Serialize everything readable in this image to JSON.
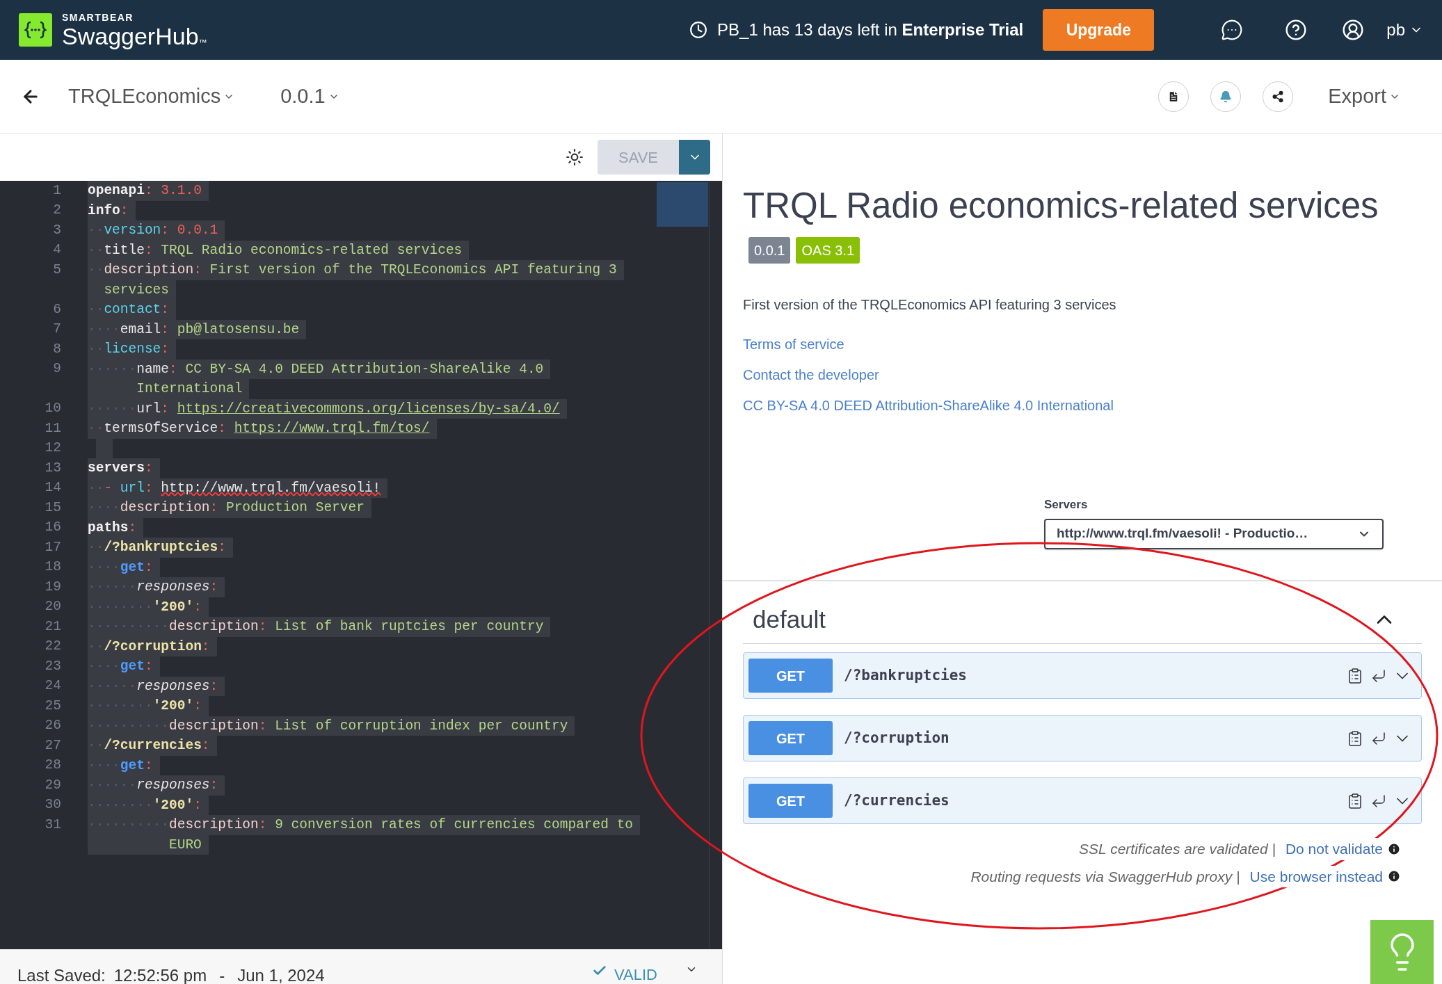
{
  "top_bar": {
    "brand_small": "SMARTBEAR",
    "brand": "SwaggerHub",
    "brand_mark": "™",
    "trial_notice": "PB_1 has 13 days left in **Enterprise Trial**",
    "upgrade_button": "Upgrade",
    "user": "pb"
  },
  "header": {
    "api_name": "TRQLEconomics",
    "version": "0.0.1",
    "export": "Export"
  },
  "editor": {
    "save_button": "SAVE",
    "save_disabled": true,
    "rows": [
      {
        "number": "1",
        "tokens": [
          {
            "kind": "key_bold",
            "text": "openapi"
          },
          {
            "kind": "punct",
            "text": ": "
          },
          {
            "kind": "number",
            "text": "3.1.0"
          }
        ]
      },
      {
        "number": "2",
        "tokens": [
          {
            "kind": "key_bold",
            "text": "info"
          },
          {
            "kind": "punct",
            "text": ":"
          }
        ]
      },
      {
        "number": "3",
        "tokens": [
          {
            "kind": "dots",
            "text": "··"
          },
          {
            "kind": "key_cyan",
            "text": "version"
          },
          {
            "kind": "punct",
            "text": ": "
          },
          {
            "kind": "number",
            "text": "0.0.1"
          }
        ]
      },
      {
        "number": "4",
        "tokens": [
          {
            "kind": "dots",
            "text": "··"
          },
          {
            "kind": "key",
            "text": "title"
          },
          {
            "kind": "punct",
            "text": ": "
          },
          {
            "kind": "string",
            "text": "TRQL Radio economics-related services"
          }
        ]
      },
      {
        "number": "5",
        "tokens": [
          {
            "kind": "dots",
            "text": "··"
          },
          {
            "kind": "key_pink",
            "text": "description"
          },
          {
            "kind": "punct",
            "text": ": "
          },
          {
            "kind": "string",
            "text": "First version of the TRQLEconomics API featuring 3"
          }
        ]
      },
      {
        "tokens": [
          {
            "kind": "string",
            "text": "  services"
          }
        ]
      },
      {
        "number": "6",
        "tokens": [
          {
            "kind": "dots",
            "text": "··"
          },
          {
            "kind": "key_cyan",
            "text": "contact"
          },
          {
            "kind": "punct",
            "text": ":"
          }
        ]
      },
      {
        "number": "7",
        "tokens": [
          {
            "kind": "dots",
            "text": "····"
          },
          {
            "kind": "key",
            "text": "email"
          },
          {
            "kind": "punct",
            "text": ": "
          },
          {
            "kind": "string",
            "text": "pb@latosensu.be"
          }
        ]
      },
      {
        "number": "8",
        "tokens": [
          {
            "kind": "dots",
            "text": "··"
          },
          {
            "kind": "key_cyan",
            "text": "license"
          },
          {
            "kind": "punct",
            "text": ":"
          }
        ]
      },
      {
        "number": "9",
        "tokens": [
          {
            "kind": "dots",
            "text": "······"
          },
          {
            "kind": "key",
            "text": "name"
          },
          {
            "kind": "punct",
            "text": ": "
          },
          {
            "kind": "string",
            "text": "CC BY-SA 4.0 DEED Attribution-ShareAlike 4.0"
          }
        ]
      },
      {
        "tokens": [
          {
            "kind": "string",
            "text": "      International"
          }
        ]
      },
      {
        "number": "10",
        "tokens": [
          {
            "kind": "dots",
            "text": "······"
          },
          {
            "kind": "key",
            "text": "url"
          },
          {
            "kind": "punct",
            "text": ": "
          },
          {
            "kind": "link",
            "text": "https://creativecommons.org/licenses/by-sa/4.0/"
          }
        ]
      },
      {
        "number": "11",
        "tokens": [
          {
            "kind": "dots",
            "text": "··"
          },
          {
            "kind": "key",
            "text": "termsOfService"
          },
          {
            "kind": "punct",
            "text": ": "
          },
          {
            "kind": "link",
            "text": "https://www.trql.fm/tos/"
          }
        ]
      },
      {
        "number": "12"
      },
      {
        "number": "13",
        "tokens": [
          {
            "kind": "key_bold",
            "text": "servers"
          },
          {
            "kind": "punct",
            "text": ":"
          }
        ]
      },
      {
        "number": "14",
        "tokens": [
          {
            "kind": "dots",
            "text": "··"
          },
          {
            "kind": "punct",
            "text": "- "
          },
          {
            "kind": "key_cyan",
            "text": "url"
          },
          {
            "kind": "punct",
            "text": ": "
          },
          {
            "kind": "error_link",
            "text": "http://www.trql.fm/vaesoli!"
          }
        ]
      },
      {
        "number": "15",
        "tokens": [
          {
            "kind": "dots",
            "text": "····"
          },
          {
            "kind": "key_pink",
            "text": "description"
          },
          {
            "kind": "punct",
            "text": ": "
          },
          {
            "kind": "string",
            "text": "Production Server"
          }
        ]
      },
      {
        "number": "16",
        "tokens": [
          {
            "kind": "key_bold",
            "text": "paths"
          },
          {
            "kind": "punct",
            "text": ":"
          }
        ]
      },
      {
        "number": "17",
        "tokens": [
          {
            "kind": "dots",
            "text": "··"
          },
          {
            "kind": "path",
            "text": "/?bankruptcies"
          },
          {
            "kind": "punct",
            "text": ":"
          }
        ]
      },
      {
        "number": "18",
        "tokens": [
          {
            "kind": "dots",
            "text": "····"
          },
          {
            "kind": "key_blue",
            "text": "get"
          },
          {
            "kind": "punct",
            "text": ":"
          }
        ]
      },
      {
        "number": "19",
        "tokens": [
          {
            "kind": "dots",
            "text": "······"
          },
          {
            "kind": "key_italic",
            "text": "responses"
          },
          {
            "kind": "punct",
            "text": ":"
          }
        ]
      },
      {
        "number": "20",
        "tokens": [
          {
            "kind": "dots",
            "text": "········"
          },
          {
            "kind": "path",
            "text": "'200'"
          },
          {
            "kind": "punct",
            "text": ":"
          }
        ]
      },
      {
        "number": "21",
        "tokens": [
          {
            "kind": "dots",
            "text": "··········"
          },
          {
            "kind": "key_pink",
            "text": "description"
          },
          {
            "kind": "punct",
            "text": ": "
          },
          {
            "kind": "string",
            "text": "List of bank ruptcies per country"
          }
        ]
      },
      {
        "number": "22",
        "tokens": [
          {
            "kind": "dots",
            "text": "··"
          },
          {
            "kind": "path",
            "text": "/?corruption"
          },
          {
            "kind": "punct",
            "text": ":"
          }
        ]
      },
      {
        "number": "23",
        "tokens": [
          {
            "kind": "dots",
            "text": "····"
          },
          {
            "kind": "key_blue",
            "text": "get"
          },
          {
            "kind": "punct",
            "text": ":"
          }
        ]
      },
      {
        "number": "24",
        "tokens": [
          {
            "kind": "dots",
            "text": "······"
          },
          {
            "kind": "key_italic",
            "text": "responses"
          },
          {
            "kind": "punct",
            "text": ":"
          }
        ]
      },
      {
        "number": "25",
        "tokens": [
          {
            "kind": "dots",
            "text": "········"
          },
          {
            "kind": "path",
            "text": "'200'"
          },
          {
            "kind": "punct",
            "text": ":"
          }
        ]
      },
      {
        "number": "26",
        "tokens": [
          {
            "kind": "dots",
            "text": "··········"
          },
          {
            "kind": "key_pink",
            "text": "description"
          },
          {
            "kind": "punct",
            "text": ": "
          },
          {
            "kind": "string",
            "text": "List of corruption index per country"
          }
        ]
      },
      {
        "number": "27",
        "tokens": [
          {
            "kind": "dots",
            "text": "··"
          },
          {
            "kind": "path",
            "text": "/?currencies"
          },
          {
            "kind": "punct",
            "text": ":"
          }
        ]
      },
      {
        "number": "28",
        "tokens": [
          {
            "kind": "dots",
            "text": "····"
          },
          {
            "kind": "key_blue",
            "text": "get"
          },
          {
            "kind": "punct",
            "text": ":"
          }
        ]
      },
      {
        "number": "29",
        "tokens": [
          {
            "kind": "dots",
            "text": "······"
          },
          {
            "kind": "key_italic",
            "text": "responses"
          },
          {
            "kind": "punct",
            "text": ":"
          }
        ]
      },
      {
        "number": "30",
        "tokens": [
          {
            "kind": "dots",
            "text": "········"
          },
          {
            "kind": "path",
            "text": "'200'"
          },
          {
            "kind": "punct",
            "text": ":"
          }
        ]
      },
      {
        "number": "31",
        "tokens": [
          {
            "kind": "dots",
            "text": "··········"
          },
          {
            "kind": "key_pink",
            "text": "description"
          },
          {
            "kind": "punct",
            "text": ": "
          },
          {
            "kind": "string",
            "text": "9 conversion rates of currencies compared to"
          }
        ]
      },
      {
        "tokens": [
          {
            "kind": "string",
            "text": "          EURO"
          }
        ]
      }
    ]
  },
  "status_bar": {
    "label": "Last Saved:",
    "time": "12:52:56 pm",
    "separator": "-",
    "date": "Jun 1, 2024",
    "validity": "VALID"
  },
  "docs": {
    "title": "TRQL Radio economics-related services",
    "badges": [
      {
        "text": "0.0.1",
        "color": "#7d8492"
      },
      {
        "text": "OAS 3.1",
        "color": "#89bf04"
      }
    ],
    "description": "First version of the TRQLEconomics API featuring 3 services",
    "links": [
      "Terms of service",
      "Contact the developer",
      "CC BY-SA 4.0 DEED Attribution-ShareAlike 4.0 International"
    ],
    "servers": {
      "label": "Servers",
      "value": "http://www.trql.fm/vaesoli! - Productio…"
    },
    "section": {
      "name": "default",
      "expanded": true,
      "operations": [
        {
          "method": "GET",
          "path": "/?bankruptcies"
        },
        {
          "method": "GET",
          "path": "/?corruption"
        },
        {
          "method": "GET",
          "path": "/?currencies"
        }
      ]
    },
    "notes": [
      {
        "text": "SSL certificates are validated |",
        "link": "Do not validate"
      },
      {
        "text": "Routing requests via SwaggerHub proxy |",
        "link": "Use browser instead"
      }
    ]
  }
}
